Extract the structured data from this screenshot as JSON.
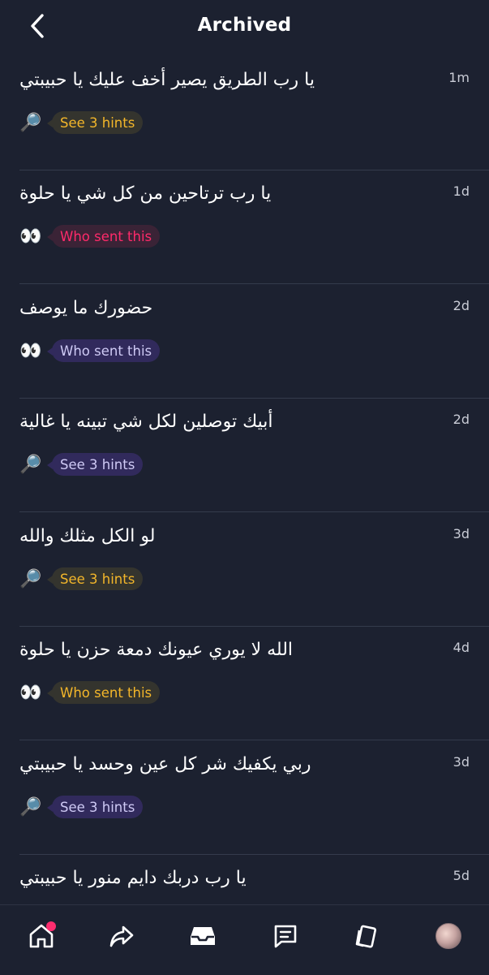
{
  "header": {
    "title": "Archived",
    "back_icon": "chevron-left-icon"
  },
  "items": [
    {
      "text": "يا رب الطريق يصير أخف عليك يا حبيبتي",
      "time": "1m",
      "emoji": "🔎",
      "pill": "See 3 hints",
      "pill_color": "yellow"
    },
    {
      "text": "يا رب ترتاحين من كل شي يا حلوة",
      "time": "1d",
      "emoji": "👀",
      "pill": "Who sent this",
      "pill_color": "pink"
    },
    {
      "text": "حضورك ما يوصف",
      "time": "2d",
      "emoji": "👀",
      "pill": "Who sent this",
      "pill_color": "purple"
    },
    {
      "text": "أبيك توصلين لكل شي تبينه يا غالية",
      "time": "2d",
      "emoji": "🔎",
      "pill": "See 3 hints",
      "pill_color": "purple"
    },
    {
      "text": "لو الكل مثلك والله",
      "time": "3d",
      "emoji": "🔎",
      "pill": "See 3 hints",
      "pill_color": "yellow"
    },
    {
      "text": "الله لا يوري عيونك دمعة حزن يا حلوة",
      "time": "4d",
      "emoji": "👀",
      "pill": "Who sent this",
      "pill_color": "yellow"
    },
    {
      "text": "ربي يكفيك شر كل عين وحسد يا حبيبتي",
      "time": "3d",
      "emoji": "🔎",
      "pill": "See 3 hints",
      "pill_color": "purple"
    },
    {
      "text": "يا رب دربك دايم منور يا حبيبتي",
      "time": "5d"
    }
  ],
  "tabbar": {
    "tabs": [
      "home-icon",
      "share-icon",
      "inbox-icon",
      "chat-icon",
      "cards-icon",
      "profile-avatar"
    ]
  },
  "colors": {
    "background": "#1c2130",
    "yellow": "#f3b62a",
    "pink": "#ff2a6a",
    "purple": "#cfcaf5",
    "badge": "#ff2d6f"
  }
}
